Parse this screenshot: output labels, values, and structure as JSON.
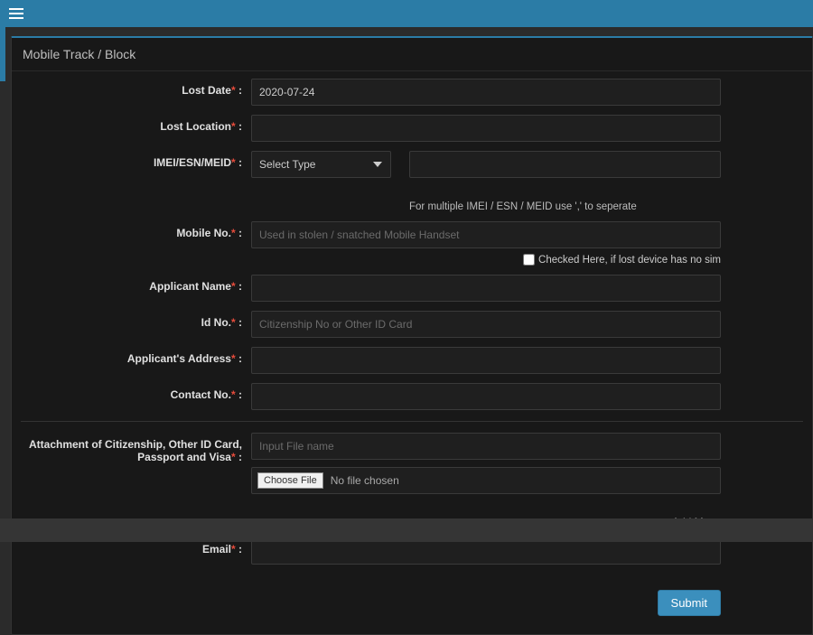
{
  "panel": {
    "title": "Mobile Track / Block"
  },
  "labels": {
    "lost_date": "Lost Date",
    "lost_location": "Lost Location",
    "imei": "IMEI/ESN/MEID",
    "mobile_no": "Mobile No.",
    "applicant_name": "Applicant Name",
    "id_no": "Id No.",
    "address": "Applicant's Address",
    "contact_no": "Contact No.",
    "attachment": "Attachment of Citizenship, Other ID Card, Passport and Visa",
    "email": "Email"
  },
  "required_mark": "*",
  "colon": " :",
  "values": {
    "lost_date": "2020-07-24",
    "imei_type_selected": "Select Type"
  },
  "placeholders": {
    "mobile_no": "Used in stolen / snatched Mobile Handset",
    "id_no": "Citizenship No or Other ID Card",
    "file_name": "Input File name"
  },
  "helper": {
    "imei": "For multiple IMEI / ESN / MEID use ',' to seperate",
    "no_sim": "Checked Here, if lost device has no sim"
  },
  "file": {
    "choose": "Choose File",
    "none": "No file chosen"
  },
  "actions": {
    "add_more": "Add More",
    "submit": "Submit"
  }
}
